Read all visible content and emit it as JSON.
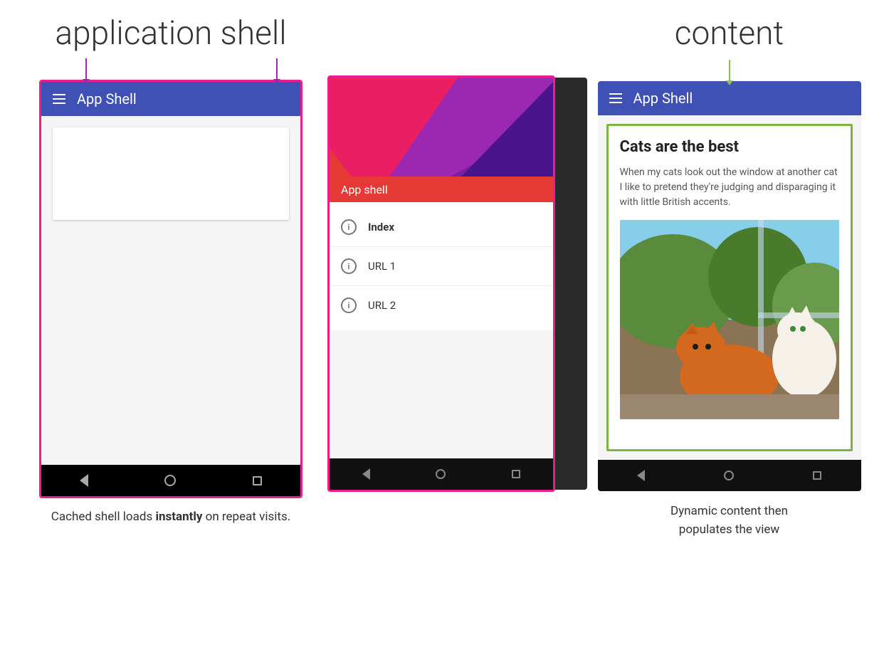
{
  "header": {
    "app_shell_label": "application shell",
    "content_label": "content"
  },
  "phone1": {
    "toolbar_title": "App Shell",
    "nav_back": "◁",
    "nav_home": "○",
    "nav_recent": "□"
  },
  "phone2": {
    "toolbar_overlay": "App shell",
    "nav_items": [
      {
        "label": "Index",
        "bold": true
      },
      {
        "label": "URL 1",
        "bold": false
      },
      {
        "label": "URL 2",
        "bold": false
      }
    ]
  },
  "phone3": {
    "toolbar_title": "App Shell",
    "content_title": "Cats are the best",
    "content_description": "When my cats look out the window at another cat I like to pretend they're judging and disparaging it with little British accents."
  },
  "captions": {
    "left": "Cached shell loads ",
    "left_bold": "instantly",
    "left_end": " on repeat visits.",
    "right_line1": "Dynamic content then",
    "right_line2": "populates the view"
  },
  "colors": {
    "pink_border": "#e91e8c",
    "blue_toolbar": "#3f51b5",
    "purple_arrow": "#9c27b0",
    "green_arrow": "#8bc34a",
    "green_border": "#7cb342"
  }
}
